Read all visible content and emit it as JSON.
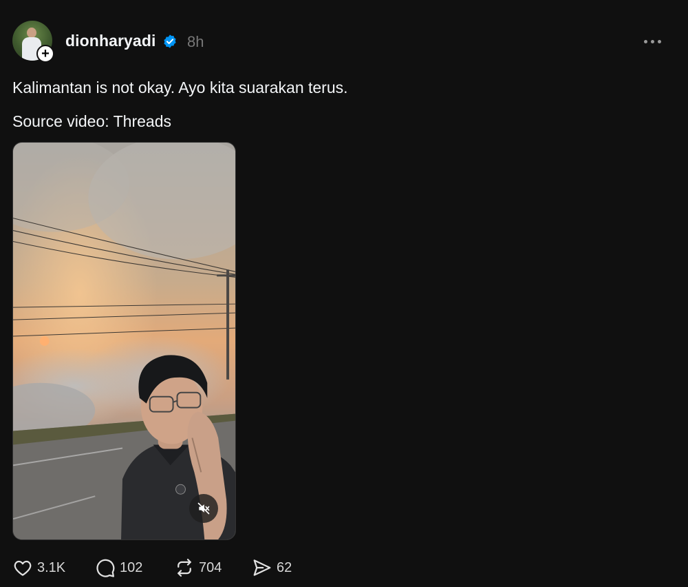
{
  "post": {
    "username": "dionharyadi",
    "time": "8h",
    "caption": "Kalimantan is not okay. Ayo kita suarakan terus.",
    "source": "Source video: Threads"
  },
  "stats": {
    "likes": "3.1K",
    "replies": "102",
    "reposts": "704",
    "shares": "62"
  },
  "colors": {
    "background": "#101010",
    "text": "#f3f5f7",
    "muted": "#777777",
    "verified": "#0095f6"
  },
  "icons": {
    "verified": "verified-badge-icon",
    "more": "more-horizontal-icon",
    "follow": "plus-icon",
    "like": "heart-icon",
    "reply": "comment-icon",
    "repost": "repost-icon",
    "share": "send-icon",
    "mute": "speaker-muted-icon"
  }
}
